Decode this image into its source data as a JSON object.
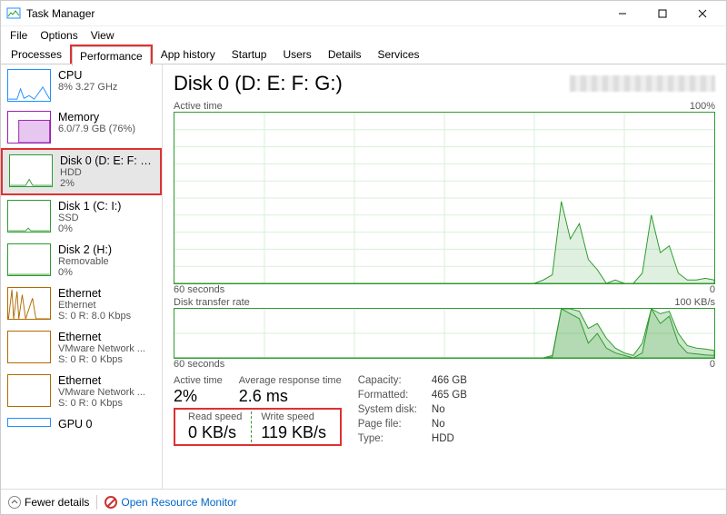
{
  "window": {
    "title": "Task Manager",
    "controls": {
      "min": "minimize",
      "max": "maximize",
      "close": "close"
    }
  },
  "menu": [
    "File",
    "Options",
    "View"
  ],
  "tabs": [
    "Processes",
    "Performance",
    "App history",
    "Startup",
    "Users",
    "Details",
    "Services"
  ],
  "active_tab": 1,
  "sidebar": [
    {
      "label": "CPU",
      "sub1": "8% 3.27 GHz",
      "sub2": "",
      "thumb": "cpu"
    },
    {
      "label": "Memory",
      "sub1": "6.0/7.9 GB (76%)",
      "sub2": "",
      "thumb": "mem"
    },
    {
      "label": "Disk 0 (D: E: F: G:)",
      "sub1": "HDD",
      "sub2": "2%",
      "thumb": "disk",
      "selected": true
    },
    {
      "label": "Disk 1 (C: I:)",
      "sub1": "SSD",
      "sub2": "0%",
      "thumb": "disk"
    },
    {
      "label": "Disk 2 (H:)",
      "sub1": "Removable",
      "sub2": "0%",
      "thumb": "disk"
    },
    {
      "label": "Ethernet",
      "sub1": "Ethernet",
      "sub2": "S: 0 R: 8.0 Kbps",
      "thumb": "eth"
    },
    {
      "label": "Ethernet",
      "sub1": "VMware Network ...",
      "sub2": "S: 0 R: 0 Kbps",
      "thumb": "eth2"
    },
    {
      "label": "Ethernet",
      "sub1": "VMware Network ...",
      "sub2": "S: 0 R: 0 Kbps",
      "thumb": "eth2"
    },
    {
      "label": "GPU 0",
      "sub1": "",
      "sub2": "",
      "thumb": "gpu"
    }
  ],
  "detail": {
    "title": "Disk 0 (D: E: F: G:)",
    "chart1": {
      "label": "Active time",
      "max_label": "100%",
      "xmin": "60 seconds",
      "xmax": "0"
    },
    "chart2": {
      "label": "Disk transfer rate",
      "max_label": "100 KB/s",
      "xmin": "60 seconds",
      "xmax": "0"
    },
    "stats": {
      "active_time": {
        "k": "Active time",
        "v": "2%"
      },
      "avg_resp": {
        "k": "Average response time",
        "v": "2.6 ms"
      },
      "read": {
        "k": "Read speed",
        "v": "0 KB/s"
      },
      "write": {
        "k": "Write speed",
        "v": "119 KB/s"
      }
    },
    "info": {
      "Capacity:": "466 GB",
      "Formatted:": "465 GB",
      "System disk:": "No",
      "Page file:": "No",
      "Type:": "HDD"
    }
  },
  "bottom": {
    "fewer": "Fewer details",
    "orm": "Open Resource Monitor"
  },
  "chart_data": [
    {
      "type": "line",
      "title": "Active time",
      "ylabel": "%",
      "ylim": [
        0,
        100
      ],
      "xlabel": "seconds",
      "xlim": [
        60,
        0
      ],
      "series": [
        {
          "name": "Active time",
          "values": [
            0,
            0,
            0,
            0,
            0,
            0,
            0,
            0,
            0,
            0,
            0,
            0,
            0,
            0,
            0,
            0,
            0,
            0,
            0,
            0,
            0,
            0,
            0,
            0,
            0,
            0,
            0,
            0,
            0,
            0,
            0,
            0,
            0,
            0,
            0,
            0,
            0,
            0,
            0,
            0,
            0,
            2,
            5,
            48,
            26,
            35,
            14,
            8,
            0,
            2,
            0,
            0,
            6,
            40,
            18,
            22,
            6,
            2,
            2,
            3,
            2
          ]
        }
      ]
    },
    {
      "type": "line",
      "title": "Disk transfer rate",
      "ylabel": "KB/s",
      "ylim": [
        0,
        100
      ],
      "xlabel": "seconds",
      "xlim": [
        60,
        0
      ],
      "series": [
        {
          "name": "Read",
          "values": [
            0,
            0,
            0,
            0,
            0,
            0,
            0,
            0,
            0,
            0,
            0,
            0,
            0,
            0,
            0,
            0,
            0,
            0,
            0,
            0,
            0,
            0,
            0,
            0,
            0,
            0,
            0,
            0,
            0,
            0,
            0,
            0,
            0,
            0,
            0,
            0,
            0,
            0,
            0,
            0,
            0,
            0,
            5,
            100,
            90,
            80,
            30,
            50,
            20,
            10,
            5,
            0,
            10,
            100,
            70,
            85,
            30,
            10,
            8,
            6,
            5
          ]
        },
        {
          "name": "Write",
          "values": [
            0,
            0,
            0,
            0,
            0,
            0,
            0,
            0,
            0,
            0,
            0,
            0,
            0,
            0,
            0,
            0,
            0,
            0,
            0,
            0,
            0,
            0,
            0,
            0,
            0,
            0,
            0,
            0,
            0,
            0,
            0,
            0,
            0,
            0,
            0,
            0,
            0,
            0,
            0,
            0,
            0,
            0,
            2,
            100,
            100,
            95,
            60,
            70,
            40,
            20,
            10,
            5,
            30,
            100,
            90,
            95,
            50,
            25,
            20,
            18,
            15
          ]
        }
      ]
    }
  ]
}
